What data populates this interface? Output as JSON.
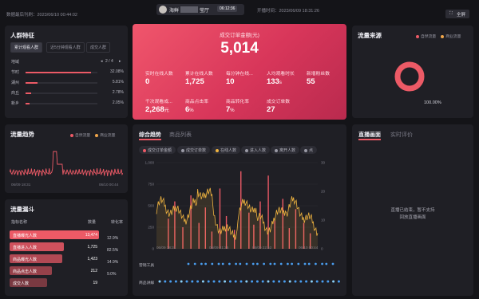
{
  "header": {
    "updated": "数据最后刊刷：2023/06/10 00:44:02",
    "room_prefix": "海鲜",
    "room_suffix": "莹厅",
    "live_timer": "06:12:36",
    "live_start": "开播时间：2023/06/09 18:31:26",
    "fullscreen": "全屏"
  },
  "audience": {
    "title": "人群特征",
    "tabs": [
      "累计观看人群",
      "近5分钟观看人群",
      "成交人群"
    ],
    "column": "地域",
    "pager": "2 / 4",
    "rows": [
      {
        "name": "节时",
        "pct": "32.08%",
        "value": 32.08
      },
      {
        "name": "湖州",
        "pct": "5.81%",
        "value": 5.81
      },
      {
        "name": "商丘",
        "pct": "2.78%",
        "value": 2.78
      },
      {
        "name": "新乡",
        "pct": "2.05%",
        "value": 2.05
      }
    ]
  },
  "kpi": {
    "title": "成交订单金额(元)",
    "amount": "5,014",
    "row1": [
      {
        "label": "实时在线人数",
        "value": "0"
      },
      {
        "label": "累计在线人数",
        "value": "1,725"
      },
      {
        "label": "每分钟在线...",
        "value": "10"
      },
      {
        "label": "人均观看时长",
        "value": "133",
        "unit": "s"
      },
      {
        "label": "新增粉丝数",
        "value": "55"
      }
    ],
    "row2": [
      {
        "label": "千次观看成...",
        "value": "2,268",
        "unit": "元"
      },
      {
        "label": "商品点击率",
        "value": "6",
        "unit": "%"
      },
      {
        "label": "商品转化率",
        "value": "7",
        "unit": "%"
      },
      {
        "label": "成交订单数",
        "value": "27"
      }
    ]
  },
  "source": {
    "title": "流量来源",
    "legend": [
      "自然流量",
      "商业流量"
    ],
    "percent": "100.00%",
    "colors": {
      "natural": "#ec5a66",
      "paid": "#f0a64a"
    }
  },
  "trend_small": {
    "title": "流量趋势",
    "legend": [
      "自然流量",
      "商业流量"
    ],
    "x_ticks": [
      "06/09 18:31",
      "06/10 00:44"
    ]
  },
  "funnel": {
    "title": "流量漏斗",
    "col_name": "指标名称",
    "col_count": "数量",
    "col_rate": "转化率",
    "rows": [
      {
        "label": "直播曝光人数",
        "count": "13,474",
        "value": 13474
      },
      {
        "label": "直播进入人数",
        "count": "1,725",
        "value": 1725
      },
      {
        "label": "商品曝光人数",
        "count": "1,423",
        "value": 1423
      },
      {
        "label": "商品点击人数",
        "count": "212",
        "value": 212
      },
      {
        "label": "成交人数",
        "count": "19",
        "value": 19
      }
    ],
    "rates": [
      "12.9%",
      "82.5%",
      "14.9%",
      "9.0%"
    ]
  },
  "combo": {
    "tabs": [
      "综合趋势",
      "商品列表"
    ],
    "series_pills": [
      {
        "label": "成交订单金额",
        "color": "#ec5a66"
      },
      {
        "label": "成交订单数",
        "color": "#9a9aa6"
      },
      {
        "label": "在线人数",
        "color": "#f0b440"
      },
      {
        "label": "进入人数",
        "color": "#9a9aa6"
      },
      {
        "label": "离开人数",
        "color": "#9a9aa6"
      },
      {
        "label": "点",
        "color": "#9a9aa6"
      }
    ],
    "y_left": [
      "1,000",
      "750",
      "500",
      "250",
      "0"
    ],
    "y_right": [
      "30",
      "20",
      "10",
      "0"
    ],
    "x_ticks": [
      "06/09 18:31",
      "06/09 21:25",
      "06/09 22:52",
      "06/10 00:44"
    ],
    "row_labels": [
      "营销工具",
      "商品讲解"
    ]
  },
  "live": {
    "tabs": [
      "直播画面",
      "实时评价"
    ],
    "message_line1": "直播已结束，暂不支持",
    "message_line2": "回放直播画面"
  }
}
